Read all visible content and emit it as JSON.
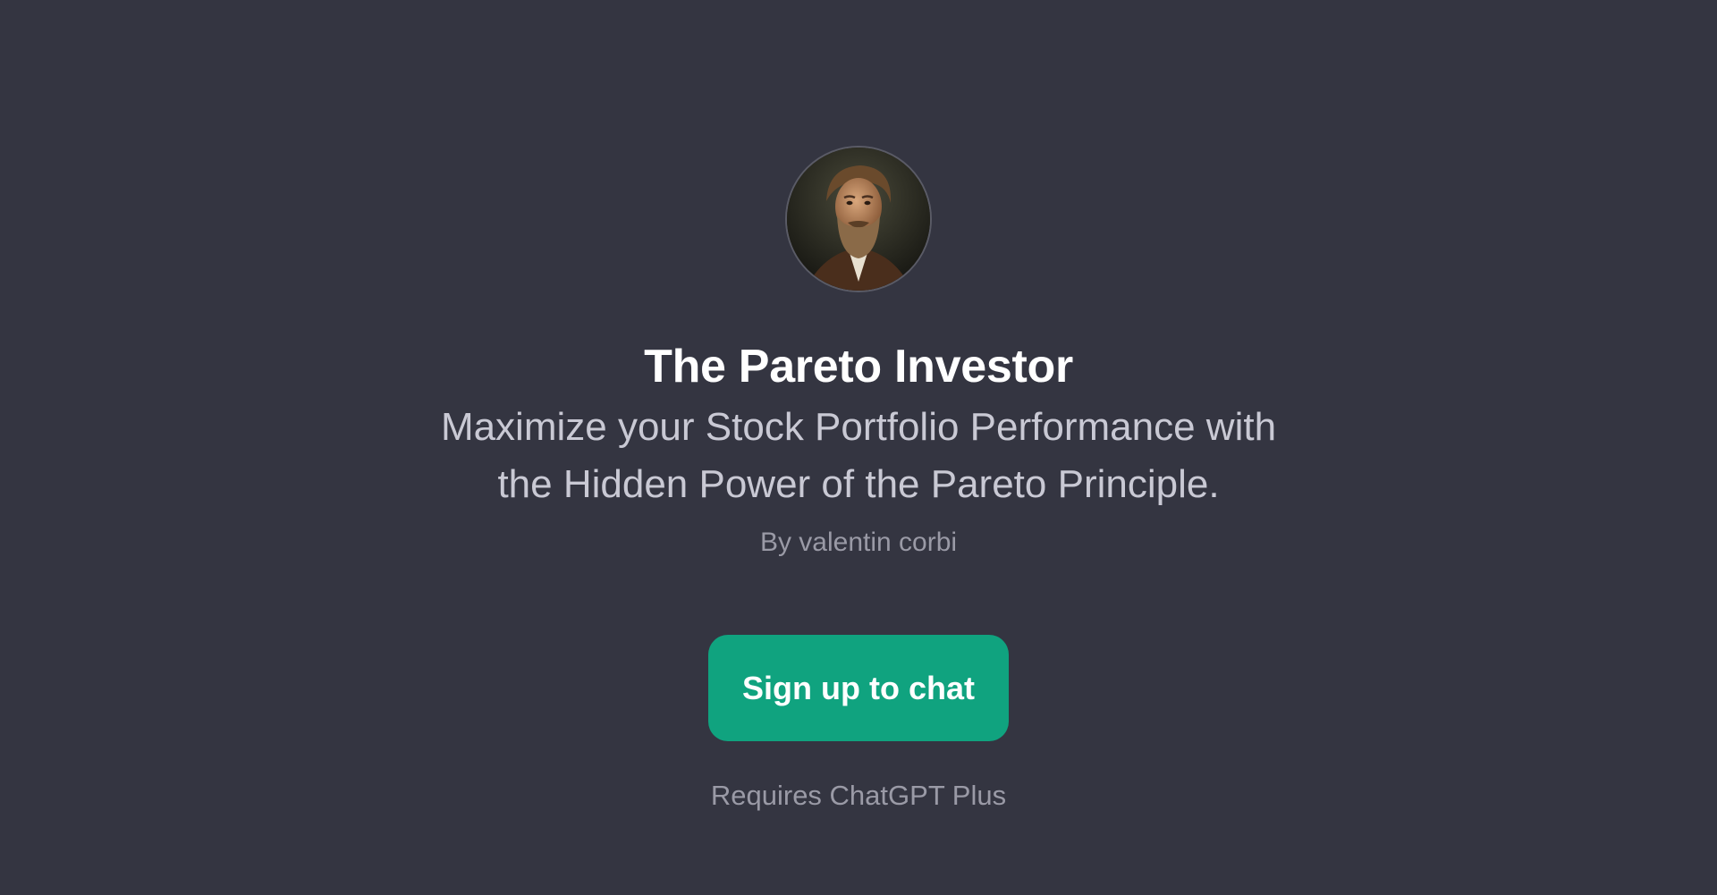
{
  "gpt": {
    "avatar_icon": "portrait-avatar",
    "name": "The Pareto Investor",
    "description": "Maximize your Stock Portfolio Performance with the Hidden Power of the Pareto Principle.",
    "author": "By valentin corbi"
  },
  "cta": {
    "label": "Sign up to chat"
  },
  "requirement": "Requires ChatGPT Plus",
  "colors": {
    "background": "#343541",
    "accent": "#10a37f",
    "title": "#ffffff",
    "subtitle": "#c9c9d4",
    "muted": "#9a9aa6"
  }
}
